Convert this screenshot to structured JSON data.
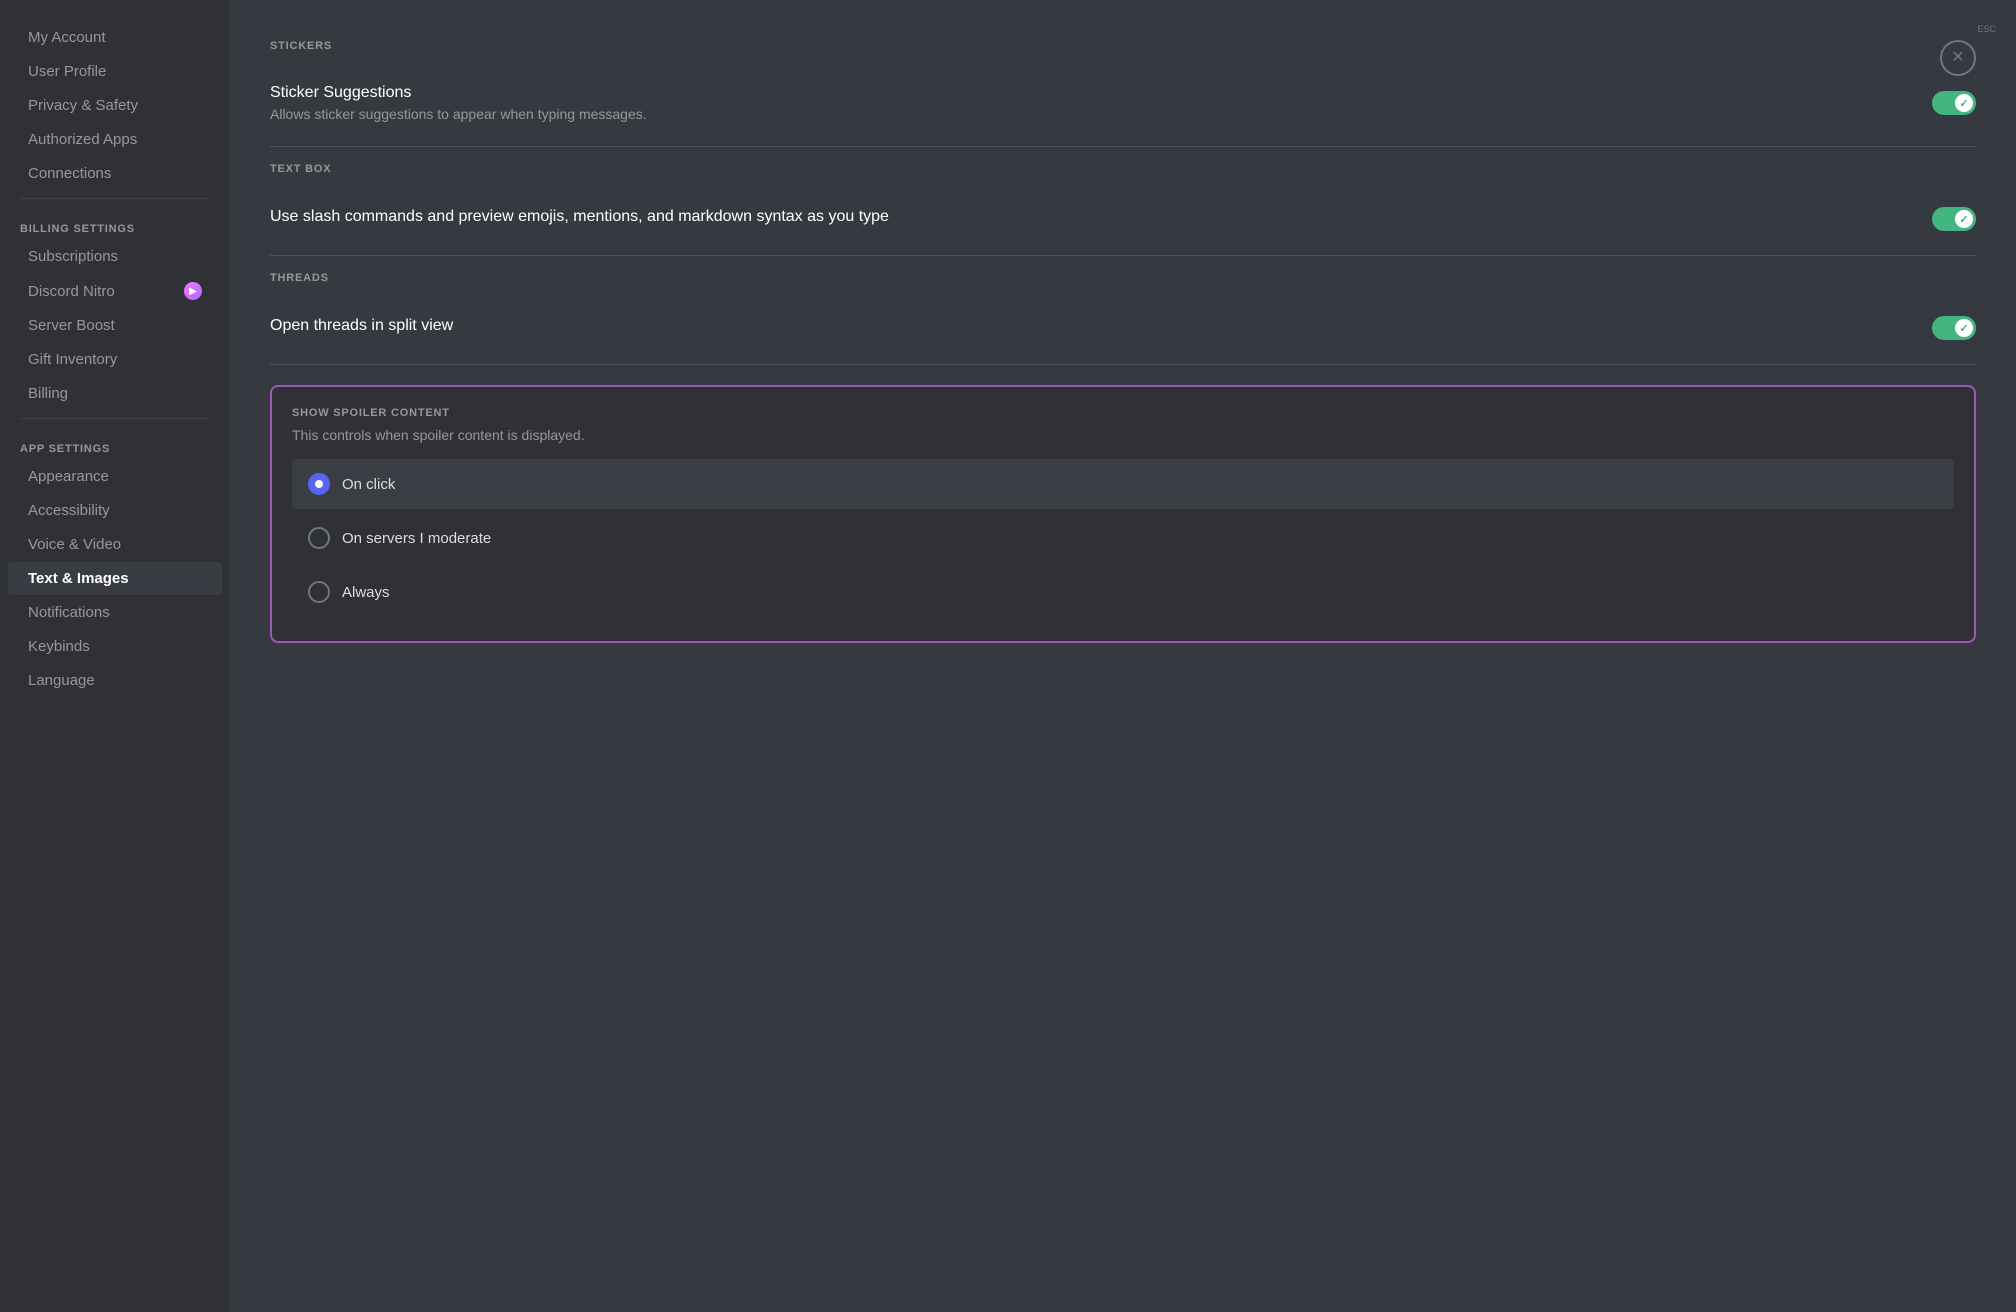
{
  "sidebar": {
    "user_settings_items": [
      {
        "id": "my-account",
        "label": "My Account",
        "active": false
      },
      {
        "id": "user-profile",
        "label": "User Profile",
        "active": false
      },
      {
        "id": "privacy-safety",
        "label": "Privacy & Safety",
        "active": false
      },
      {
        "id": "authorized-apps",
        "label": "Authorized Apps",
        "active": false
      },
      {
        "id": "connections",
        "label": "Connections",
        "active": false
      }
    ],
    "billing_section_label": "BILLING SETTINGS",
    "billing_items": [
      {
        "id": "subscriptions",
        "label": "Subscriptions",
        "active": false,
        "has_icon": false
      },
      {
        "id": "discord-nitro",
        "label": "Discord Nitro",
        "active": false,
        "has_icon": true
      },
      {
        "id": "server-boost",
        "label": "Server Boost",
        "active": false,
        "has_icon": false
      },
      {
        "id": "gift-inventory",
        "label": "Gift Inventory",
        "active": false,
        "has_icon": false
      },
      {
        "id": "billing",
        "label": "Billing",
        "active": false,
        "has_icon": false
      }
    ],
    "app_section_label": "APP SETTINGS",
    "app_items": [
      {
        "id": "appearance",
        "label": "Appearance",
        "active": false
      },
      {
        "id": "accessibility",
        "label": "Accessibility",
        "active": false
      },
      {
        "id": "voice-video",
        "label": "Voice & Video",
        "active": false
      },
      {
        "id": "text-images",
        "label": "Text & Images",
        "active": true
      },
      {
        "id": "notifications",
        "label": "Notifications",
        "active": false
      },
      {
        "id": "keybinds",
        "label": "Keybinds",
        "active": false
      },
      {
        "id": "language",
        "label": "Language",
        "active": false
      }
    ]
  },
  "main": {
    "stickers_section": {
      "title": "STICKERS",
      "label": "Sticker Suggestions",
      "desc": "Allows sticker suggestions to appear when typing messages.",
      "enabled": true
    },
    "textbox_section": {
      "title": "TEXT BOX",
      "label": "Use slash commands and preview emojis, mentions, and markdown syntax as you type",
      "enabled": true
    },
    "threads_section": {
      "title": "THREADS",
      "label": "Open threads in split view",
      "enabled": true
    },
    "spoiler_section": {
      "title": "SHOW SPOILER CONTENT",
      "desc": "This controls when spoiler content is displayed.",
      "options": [
        {
          "id": "on-click",
          "label": "On click",
          "selected": true
        },
        {
          "id": "on-servers-moderate",
          "label": "On servers I moderate",
          "selected": false
        },
        {
          "id": "always",
          "label": "Always",
          "selected": false
        }
      ]
    }
  },
  "close_button": {
    "symbol": "✕",
    "esc_label": "ESC"
  }
}
